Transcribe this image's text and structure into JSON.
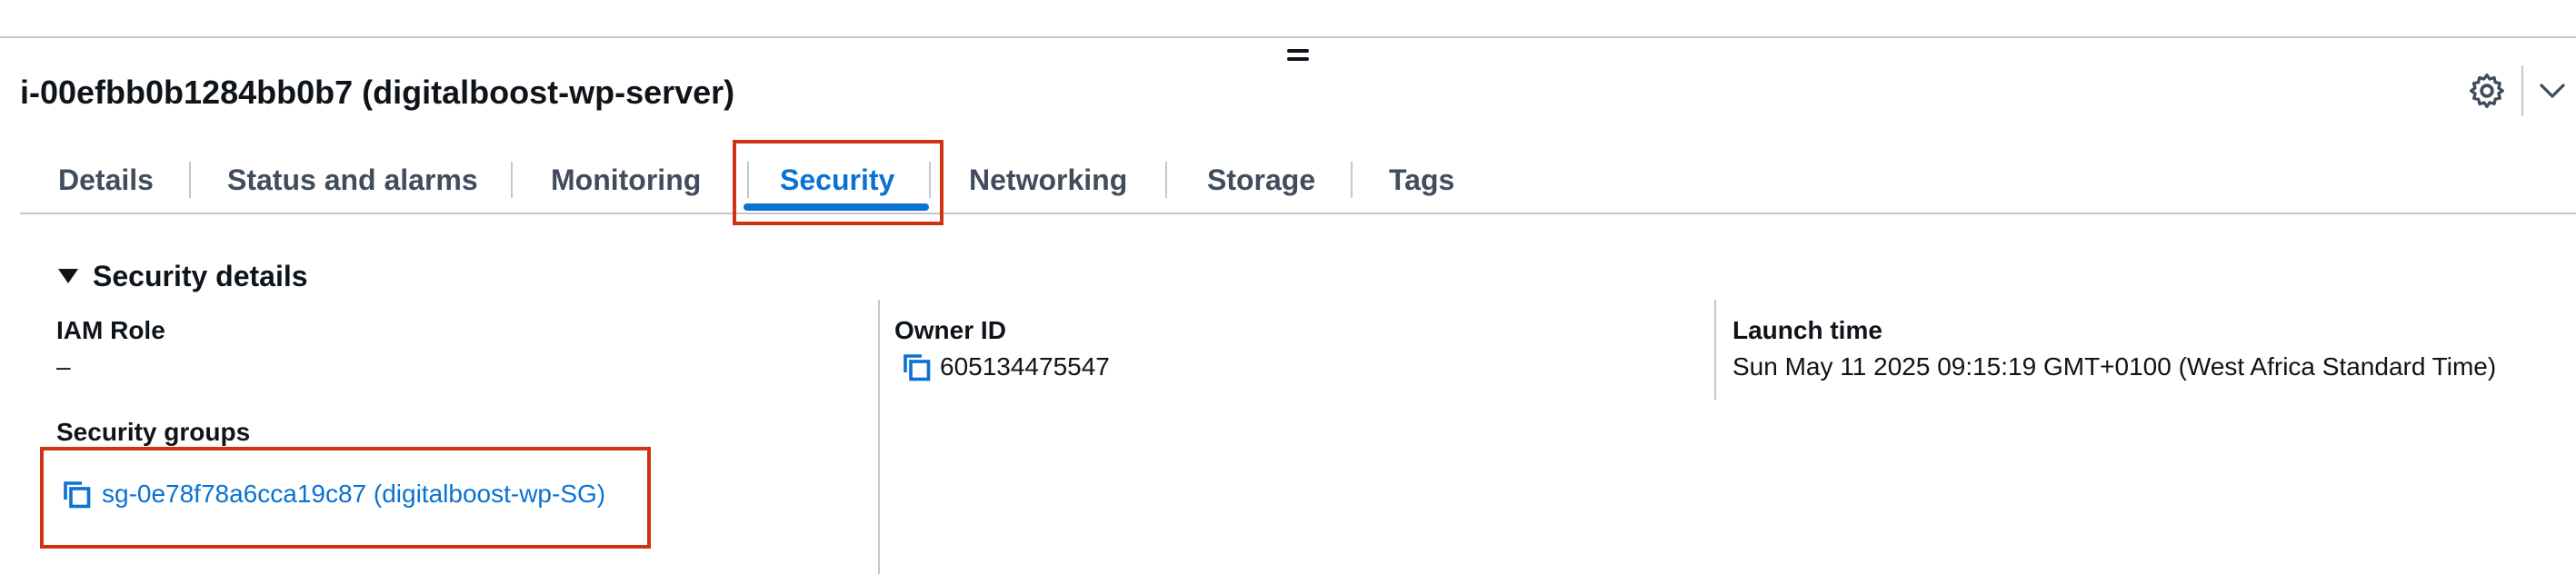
{
  "instance": {
    "title": "i-00efbb0b1284bb0b7 (digitalboost-wp-server)"
  },
  "tabs": [
    {
      "label": "Details"
    },
    {
      "label": "Status and alarms"
    },
    {
      "label": "Monitoring"
    },
    {
      "label": "Security"
    },
    {
      "label": "Networking"
    },
    {
      "label": "Storage"
    },
    {
      "label": "Tags"
    }
  ],
  "security_details": {
    "title": "Security details",
    "iam_role_label": "IAM Role",
    "iam_role_value": "–",
    "security_groups_label": "Security groups",
    "security_group_link": "sg-0e78f78a6cca19c87 (digitalboost-wp-SG)",
    "owner_id_label": "Owner ID",
    "owner_id_value": "605134475547",
    "launch_time_label": "Launch time",
    "launch_time_value": "Sun May 11 2025 09:15:19 GMT+0100 (West Africa Standard Time)"
  },
  "colors": {
    "accent": "#0972d3",
    "highlight": "#d13212"
  },
  "icons": [
    "drag-handle-icon",
    "settings-icon",
    "chevron-down-icon",
    "caret-down-icon",
    "copy-icon"
  ]
}
